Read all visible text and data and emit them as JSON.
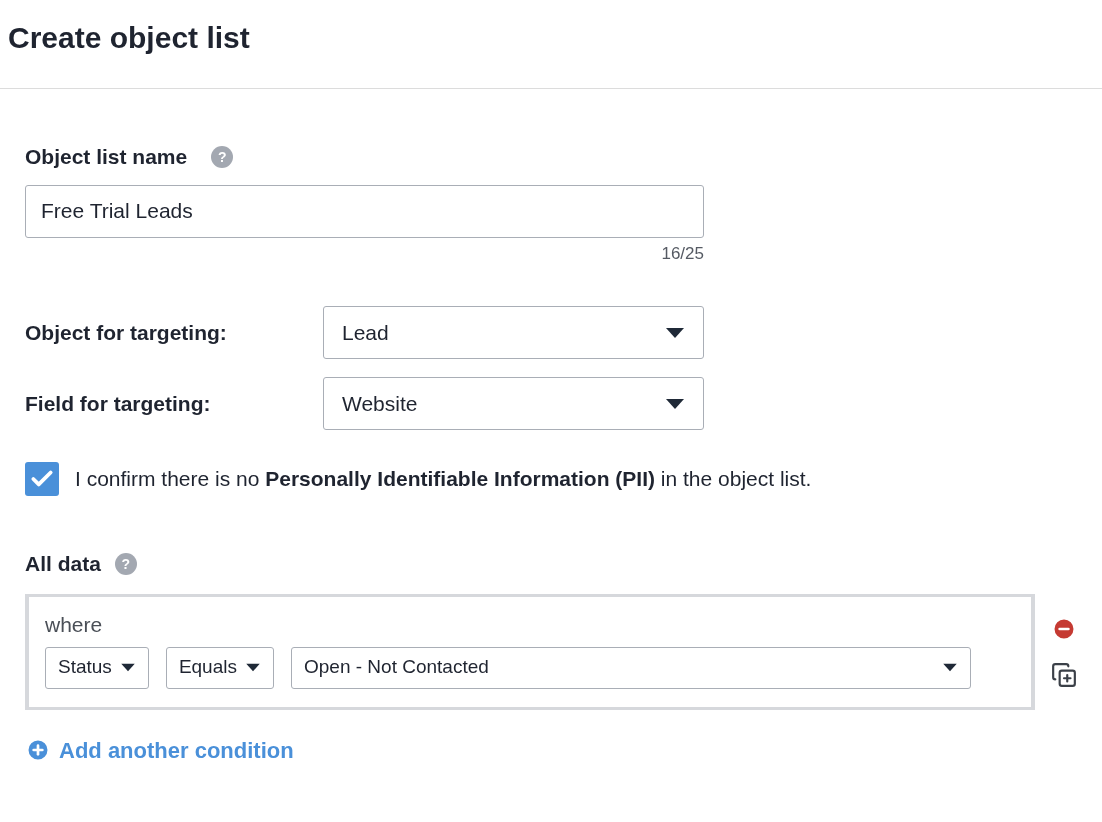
{
  "title": "Create object list",
  "name_field": {
    "label": "Object list name",
    "help": "?",
    "value": "Free Trial Leads",
    "counter": "16/25"
  },
  "targeting": [
    {
      "label": "Object for targeting:",
      "value": "Lead"
    },
    {
      "label": "Field for targeting:",
      "value": "Website"
    }
  ],
  "confirmation": {
    "checked": true,
    "text": "I confirm there is no **Personally Identifiable Information (PII)** in the object list."
  },
  "all_data": {
    "label": "All data",
    "help": "?",
    "groups": [
      {
        "where": "where",
        "conditions": [
          {
            "field": "Status",
            "operator": "Equals",
            "value": "Open - Not Contacted"
          }
        ]
      }
    ]
  },
  "add_link": "Add another condition"
}
